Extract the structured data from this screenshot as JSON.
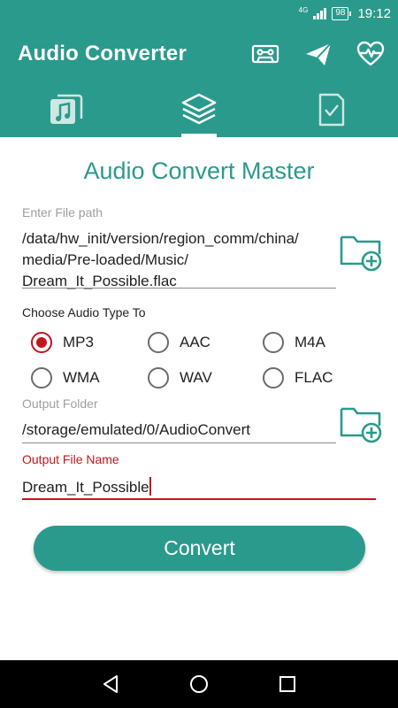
{
  "status_bar": {
    "network": "4G",
    "battery": "98",
    "time": "19:12"
  },
  "app_bar": {
    "title": "Audio Converter",
    "icons": [
      "cassette-icon",
      "paper-plane-icon",
      "heart-pulse-icon"
    ]
  },
  "tabs": [
    {
      "icon": "music-library-icon",
      "selected": false
    },
    {
      "icon": "layers-icon",
      "selected": true
    },
    {
      "icon": "checked-document-icon",
      "selected": false
    }
  ],
  "main": {
    "heading": "Audio Convert Master",
    "file_path_label": "Enter File path",
    "file_path_lines": [
      "/data/hw_init/version/region_comm/china/",
      "media/Pre-loaded/Music/",
      "Dream_It_Possible.flac"
    ],
    "audio_type_label": "Choose Audio Type To",
    "audio_types": [
      {
        "label": "MP3",
        "checked": true
      },
      {
        "label": "AAC",
        "checked": false
      },
      {
        "label": "M4A",
        "checked": false
      },
      {
        "label": "WMA",
        "checked": false
      },
      {
        "label": "WAV",
        "checked": false
      },
      {
        "label": "FLAC",
        "checked": false
      }
    ],
    "output_folder_label": "Output Folder",
    "output_folder_value": "/storage/emulated/0/AudioConvert",
    "output_name_label": "Output File Name",
    "output_name_value": "Dream_It_Possible",
    "convert_label": "Convert"
  },
  "colors": {
    "primary": "#2a9a8c",
    "accent": "#c4151c"
  }
}
